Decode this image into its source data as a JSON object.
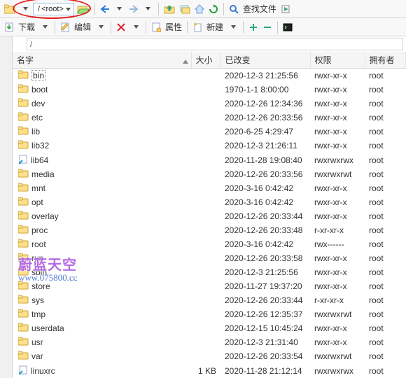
{
  "toolbar1": {
    "path_root_label": "<root>"
  },
  "toolbar2": {
    "download": "下载",
    "edit": "编辑",
    "props": "属性",
    "new": "新建"
  },
  "search_label": "查找文件",
  "current_path": "/",
  "columns": {
    "name": "名字",
    "size": "大小",
    "changed": "已改变",
    "perm": "权限",
    "owner": "拥有者"
  },
  "rows": [
    {
      "name": "bin",
      "type": "folder",
      "size": "",
      "date": "2020-12-3 21:25:56",
      "perm": "rwxr-xr-x",
      "owner": "root",
      "sel": true
    },
    {
      "name": "boot",
      "type": "folder",
      "size": "",
      "date": "1970-1-1 8:00:00",
      "perm": "rwxr-xr-x",
      "owner": "root"
    },
    {
      "name": "dev",
      "type": "folder",
      "size": "",
      "date": "2020-12-26 12:34:36",
      "perm": "rwxr-xr-x",
      "owner": "root"
    },
    {
      "name": "etc",
      "type": "folder",
      "size": "",
      "date": "2020-12-26 20:33:56",
      "perm": "rwxr-xr-x",
      "owner": "root"
    },
    {
      "name": "lib",
      "type": "folder",
      "size": "",
      "date": "2020-6-25 4:29:47",
      "perm": "rwxr-xr-x",
      "owner": "root"
    },
    {
      "name": "lib32",
      "type": "folder",
      "size": "",
      "date": "2020-12-3 21:26:11",
      "perm": "rwxr-xr-x",
      "owner": "root"
    },
    {
      "name": "lib64",
      "type": "link",
      "size": "",
      "date": "2020-11-28 19:08:40",
      "perm": "rwxrwxrwx",
      "owner": "root"
    },
    {
      "name": "media",
      "type": "folder",
      "size": "",
      "date": "2020-12-26 20:33:56",
      "perm": "rwxrwxrwt",
      "owner": "root"
    },
    {
      "name": "mnt",
      "type": "folder",
      "size": "",
      "date": "2020-3-16 0:42:42",
      "perm": "rwxr-xr-x",
      "owner": "root"
    },
    {
      "name": "opt",
      "type": "folder",
      "size": "",
      "date": "2020-3-16 0:42:42",
      "perm": "rwxr-xr-x",
      "owner": "root"
    },
    {
      "name": "overlay",
      "type": "folder",
      "size": "",
      "date": "2020-12-26 20:33:44",
      "perm": "rwxr-xr-x",
      "owner": "root"
    },
    {
      "name": "proc",
      "type": "folder",
      "size": "",
      "date": "2020-12-26 20:33:48",
      "perm": "r-xr-xr-x",
      "owner": "root"
    },
    {
      "name": "root",
      "type": "folder",
      "size": "",
      "date": "2020-3-16 0:42:42",
      "perm": "rwx------",
      "owner": "root"
    },
    {
      "name": "run",
      "type": "folder",
      "size": "",
      "date": "2020-12-26 20:33:58",
      "perm": "rwxr-xr-x",
      "owner": "root"
    },
    {
      "name": "sbin",
      "type": "folder",
      "size": "",
      "date": "2020-12-3 21:25:56",
      "perm": "rwxr-xr-x",
      "owner": "root"
    },
    {
      "name": "store",
      "type": "folder",
      "size": "",
      "date": "2020-11-27 19:37:20",
      "perm": "rwxr-xr-x",
      "owner": "root"
    },
    {
      "name": "sys",
      "type": "folder",
      "size": "",
      "date": "2020-12-26 20:33:44",
      "perm": "r-xr-xr-x",
      "owner": "root"
    },
    {
      "name": "tmp",
      "type": "folder",
      "size": "",
      "date": "2020-12-26 12:35:37",
      "perm": "rwxrwxrwt",
      "owner": "root"
    },
    {
      "name": "userdata",
      "type": "folder",
      "size": "",
      "date": "2020-12-15 10:45:24",
      "perm": "rwxr-xr-x",
      "owner": "root"
    },
    {
      "name": "usr",
      "type": "folder",
      "size": "",
      "date": "2020-12-3 21:31:40",
      "perm": "rwxr-xr-x",
      "owner": "root"
    },
    {
      "name": "var",
      "type": "folder",
      "size": "",
      "date": "2020-12-26 20:33:54",
      "perm": "rwxrwxrwt",
      "owner": "root"
    },
    {
      "name": "linuxrc",
      "type": "link",
      "size": "1 KB",
      "date": "2020-11-28 21:12:14",
      "perm": "rwxrwxrwx",
      "owner": "root"
    }
  ],
  "watermark": {
    "line1": "蔚蓝天空",
    "line2": "www.075800.cc"
  }
}
